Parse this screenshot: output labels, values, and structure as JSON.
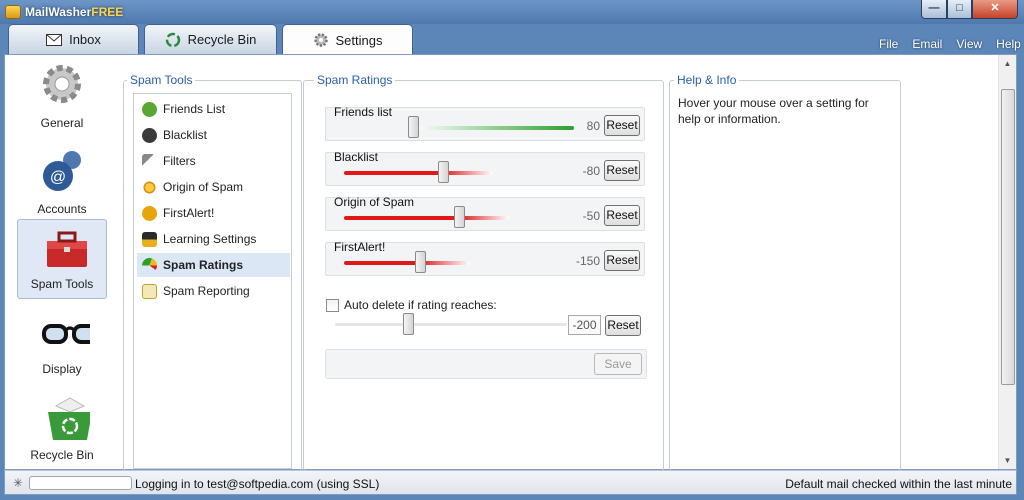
{
  "window": {
    "title_main": "MailWasher",
    "title_suffix": "FREE",
    "minimize_glyph": "—",
    "maximize_glyph": "□",
    "close_glyph": "✕"
  },
  "tabs": [
    {
      "label": "Inbox",
      "icon": "envelope-icon"
    },
    {
      "label": "Recycle Bin",
      "icon": "recycle-icon"
    },
    {
      "label": "Settings",
      "icon": "gear-icon",
      "active": true
    }
  ],
  "menu": [
    "File",
    "Email",
    "View",
    "Help"
  ],
  "nav": {
    "items": [
      {
        "label": "General",
        "icon": "gear-icon"
      },
      {
        "label": "Accounts",
        "icon": "at-sign-icon"
      },
      {
        "label": "Spam Tools",
        "icon": "toolbox-icon",
        "selected": true
      },
      {
        "label": "Display",
        "icon": "glasses-icon"
      },
      {
        "label": "Recycle Bin",
        "icon": "recycle-bin-icon"
      }
    ]
  },
  "spam_tools": {
    "heading": "Spam Tools",
    "items": [
      {
        "label": "Friends List",
        "icon": "friends-icon",
        "color": "#5aa832"
      },
      {
        "label": "Blacklist",
        "icon": "blacklist-icon",
        "color": "#3a3a3a"
      },
      {
        "label": "Filters",
        "icon": "filter-icon",
        "color": "#7a7a7a"
      },
      {
        "label": "Origin of Spam",
        "icon": "origin-icon",
        "color": "#e08a1a"
      },
      {
        "label": "FirstAlert!",
        "icon": "alert-icon",
        "color": "#e8a40c"
      },
      {
        "label": "Learning Settings",
        "icon": "graduation-cap-icon",
        "color": "#2a2a2a"
      },
      {
        "label": "Spam Ratings",
        "icon": "gauge-icon",
        "color": "#4a7ab0",
        "selected": true
      },
      {
        "label": "Spam Reporting",
        "icon": "report-icon",
        "color": "#e0b020"
      }
    ]
  },
  "spam_ratings": {
    "heading": "Spam Ratings",
    "items": [
      {
        "label": "Friends list",
        "value": "80",
        "level": 0.3,
        "reset": "Reset",
        "color": "#2aa02a"
      },
      {
        "label": "Blacklist",
        "value": "-80",
        "level": 0.43,
        "reset": "Reset",
        "color": "#e01818"
      },
      {
        "label": "Origin of Spam",
        "value": "-50",
        "level": 0.5,
        "reset": "Reset",
        "color": "#e01818"
      },
      {
        "label": "FirstAlert!",
        "value": "-150",
        "level": 0.33,
        "reset": "Reset",
        "color": "#e01818"
      }
    ],
    "auto_delete_label": "Auto delete if rating reaches:",
    "auto_delete_checked": false,
    "auto_delete_value": "-200",
    "auto_delete_reset": "Reset",
    "save_label": "Save"
  },
  "help": {
    "heading": "Help & Info",
    "text": "Hover your mouse over a setting for help or information."
  },
  "status": {
    "left": "Logging in to test@softpedia.com (using SSL)",
    "right": "Default mail checked within the last minute",
    "progress": 0.0
  },
  "colors": {
    "title_bar": "#5c86b8",
    "accent": "#2a60a8",
    "selected_bg": "#dce7f5"
  }
}
